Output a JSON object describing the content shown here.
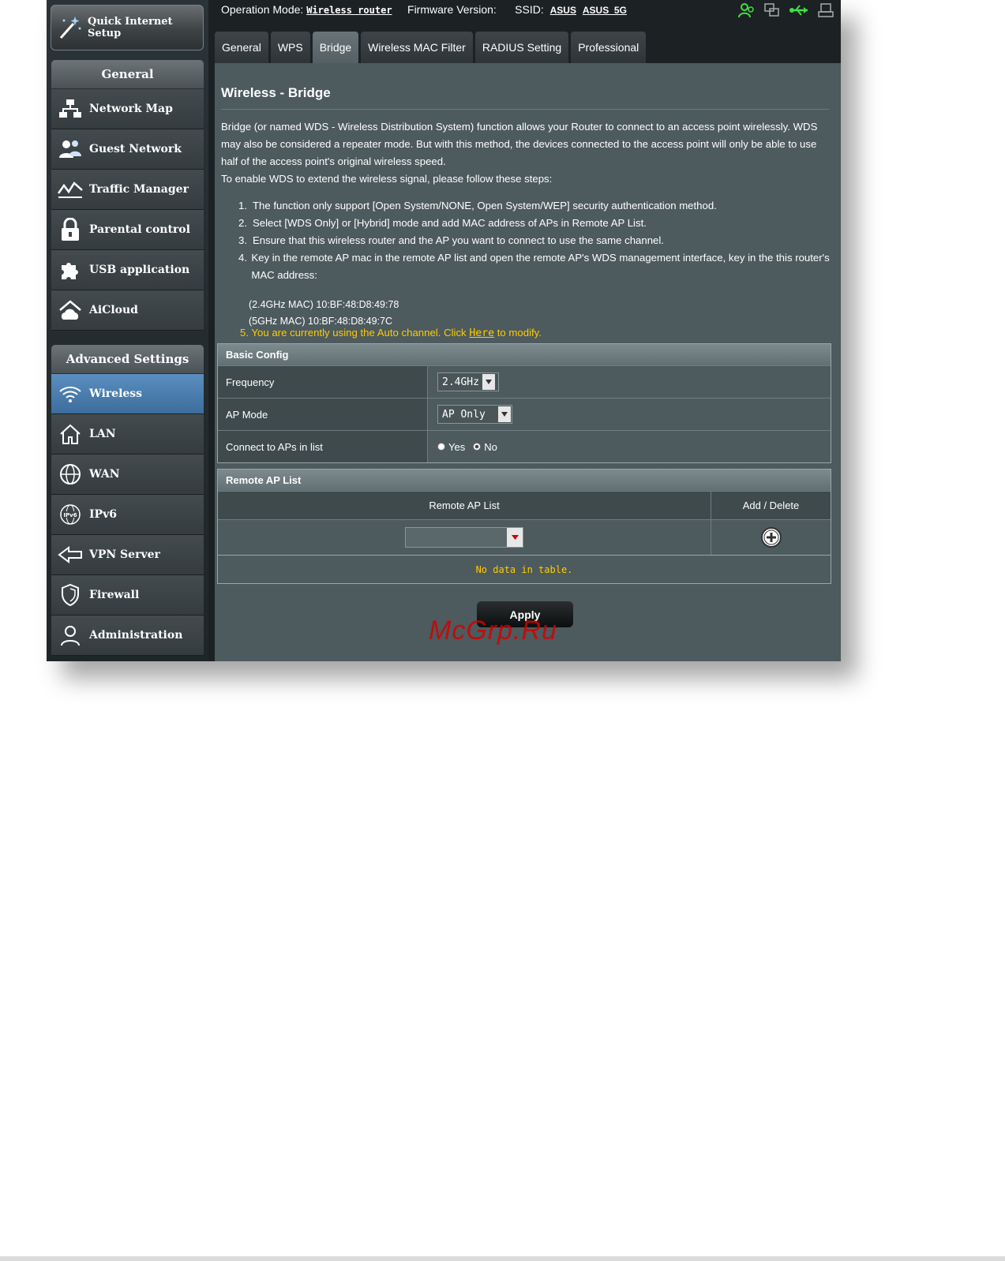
{
  "sidebar": {
    "qis_label": "Quick Internet Setup",
    "general_header": "General",
    "general_items": [
      "Network Map",
      "Guest Network",
      "Traffic Manager",
      "Parental control",
      "USB application",
      "AiCloud"
    ],
    "advanced_header": "Advanced Settings",
    "advanced_items": [
      "Wireless",
      "LAN",
      "WAN",
      "IPv6",
      "VPN Server",
      "Firewall",
      "Administration"
    ],
    "active_item": "Wireless"
  },
  "header": {
    "op_mode_label": "Operation Mode:",
    "op_mode_value": "Wireless router",
    "firmware_label": "Firmware Version:",
    "ssid_label": "SSID:",
    "ssid_1": "ASUS",
    "ssid_2": "ASUS_5G"
  },
  "tabs": [
    "General",
    "WPS",
    "Bridge",
    "Wireless MAC Filter",
    "RADIUS Setting",
    "Professional"
  ],
  "active_tab": "Bridge",
  "page": {
    "title": "Wireless - Bridge",
    "desc_1": "Bridge (or named WDS - Wireless Distribution System) function allows your Router to connect to an access point wirelessly. WDS may also be considered a repeater mode. But with this method, the devices connected to the access point will only be able to use half of the access point's original wireless speed.",
    "desc_2": "To enable WDS to extend the wireless signal, please follow these steps:",
    "steps": [
      "The function only support [Open System/NONE, Open System/WEP] security authentication method.",
      "Select [WDS Only] or [Hybrid] mode and add MAC address of APs in Remote AP List.",
      "Ensure that this wireless router and the AP you want to connect to use the same channel.",
      "Key in the remote AP mac in the remote AP list and open the remote AP's WDS management interface, key in the this router's MAC address:"
    ],
    "mac_24": "(2.4GHz MAC) 10:BF:48:D8:49:78",
    "mac_5": "(5GHz MAC) 10:BF:48:D8:49:7C",
    "note_pre": "5. You are currently using the Auto channel. Click",
    "note_link": "Here",
    "note_post": "to modify."
  },
  "basic_config": {
    "header": "Basic Config",
    "frequency_label": "Frequency",
    "frequency_value": "2.4GHz",
    "ap_mode_label": "AP Mode",
    "ap_mode_value": "AP Only",
    "connect_label": "Connect to APs in list",
    "yes_label": "Yes",
    "no_label": "No",
    "connect_selected": "No"
  },
  "remote_list": {
    "header": "Remote AP List",
    "col_1": "Remote AP List",
    "col_2": "Add / Delete",
    "empty_text": "No data in table."
  },
  "apply_label": "Apply",
  "watermark": "McGrp.Ru"
}
